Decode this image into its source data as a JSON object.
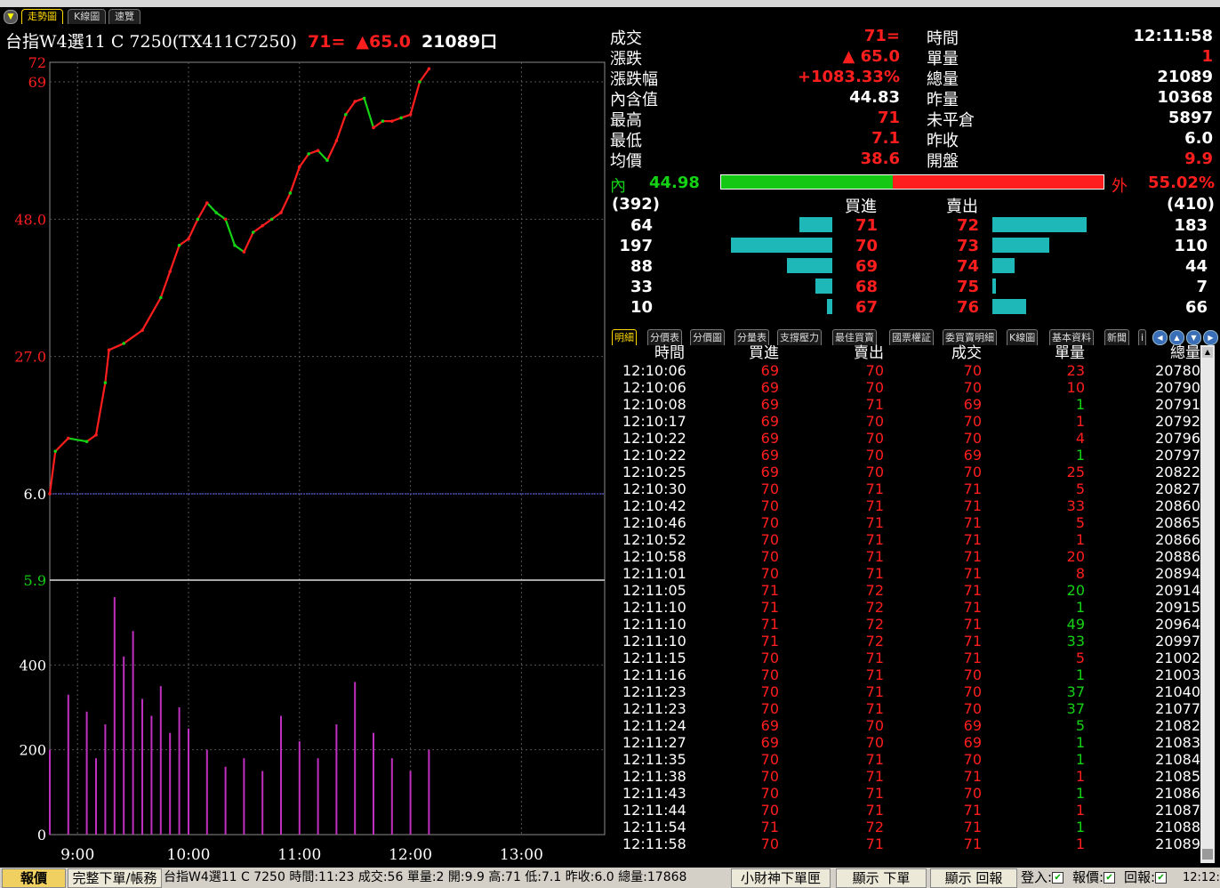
{
  "tabs": [
    {
      "label": "走勢圖",
      "active": true
    },
    {
      "label": "K線圖",
      "active": false
    },
    {
      "label": "速覽",
      "active": false
    }
  ],
  "header": {
    "name": "台指W4選11 C 7250(TX411C7250)",
    "price": "71=",
    "change": "▲65.0",
    "volume": "21089口"
  },
  "chart": {
    "price_ticks": [
      "72",
      "69",
      "48.0",
      "27.0",
      "6.0",
      "5.9"
    ],
    "volume_ticks": [
      "400",
      "200",
      "0"
    ],
    "time_ticks": [
      "9:00",
      "10:00",
      "11:00",
      "12:00",
      "13:00"
    ],
    "up_color": "#ff1e1e",
    "down_color": "#14d214",
    "avg_color": "#6a6aff",
    "vol_color": "#c030c0"
  },
  "chart_data": {
    "type": "line",
    "title": "",
    "xlabel": "",
    "ylabel": "",
    "x_range": [
      "8:45",
      "13:45"
    ],
    "ylim": [
      6.0,
      72
    ],
    "reference_price": 6.0,
    "price_series": {
      "x": [
        "8:45",
        "8:48",
        "8:55",
        "9:05",
        "9:10",
        "9:15",
        "9:17",
        "9:25",
        "9:35",
        "9:45",
        "9:50",
        "9:55",
        "10:00",
        "10:05",
        "10:10",
        "10:15",
        "10:20",
        "10:25",
        "10:30",
        "10:35",
        "10:40",
        "10:45",
        "10:50",
        "10:55",
        "11:00",
        "11:05",
        "11:10",
        "11:15",
        "11:20",
        "11:25",
        "11:30",
        "11:35",
        "11:40",
        "11:45",
        "11:50",
        "11:55",
        "12:00",
        "12:05",
        "12:10"
      ],
      "values": [
        6.0,
        12.5,
        14.5,
        14.0,
        15.0,
        23.0,
        28.0,
        29.0,
        31.0,
        36.0,
        40.0,
        44.0,
        45.0,
        48.0,
        50.5,
        49.0,
        48.0,
        44.0,
        43.0,
        46.0,
        47.0,
        48.0,
        49.0,
        52.0,
        56.0,
        58.0,
        58.5,
        57.0,
        60.0,
        64.0,
        66.0,
        66.5,
        62.0,
        63.0,
        63.0,
        63.5,
        64.0,
        69.0,
        71.0
      ]
    },
    "volume_series": {
      "ylim": [
        0,
        600
      ],
      "x": [
        "8:45",
        "8:55",
        "9:05",
        "9:10",
        "9:15",
        "9:20",
        "9:25",
        "9:30",
        "9:35",
        "9:40",
        "9:45",
        "9:50",
        "9:55",
        "10:00",
        "10:10",
        "10:20",
        "10:30",
        "10:40",
        "10:50",
        "11:00",
        "11:10",
        "11:20",
        "11:30",
        "11:40",
        "11:50",
        "12:00",
        "12:10"
      ],
      "values": [
        200,
        330,
        290,
        180,
        260,
        560,
        420,
        480,
        320,
        280,
        350,
        240,
        300,
        250,
        200,
        160,
        180,
        150,
        280,
        220,
        180,
        260,
        360,
        240,
        180,
        150,
        200
      ]
    }
  },
  "quote": {
    "left": [
      {
        "label": "成交",
        "value": "71=",
        "color": "red"
      },
      {
        "label": "漲跌",
        "value": "▲ 65.0",
        "color": "red"
      },
      {
        "label": "漲跌幅",
        "value": "+1083.33%",
        "color": "red"
      },
      {
        "label": "內含值",
        "value": "44.83",
        "color": "white"
      },
      {
        "label": "最高",
        "value": "71",
        "color": "red"
      },
      {
        "label": "最低",
        "value": "7.1",
        "color": "red"
      },
      {
        "label": "均價",
        "value": "38.6",
        "color": "red"
      }
    ],
    "right": [
      {
        "label": "時間",
        "value": "12:11:58",
        "color": "white"
      },
      {
        "label": "單量",
        "value": "1",
        "color": "red"
      },
      {
        "label": "總量",
        "value": "21089",
        "color": "white"
      },
      {
        "label": "昨量",
        "value": "10368",
        "color": "white"
      },
      {
        "label": "未平倉",
        "value": "5897",
        "color": "white"
      },
      {
        "label": "昨收",
        "value": "6.0",
        "color": "white"
      },
      {
        "label": "開盤",
        "value": "9.9",
        "color": "red"
      }
    ],
    "inner_label": "內",
    "inner_value": "44.98",
    "outer_label": "外",
    "outer_value": "55.02%",
    "inner_pct": 44.98
  },
  "depth": {
    "bid_total": "(392)",
    "ask_total": "(410)",
    "bid_header": "買進",
    "ask_header": "賣出",
    "max_qty": 197,
    "rows": [
      {
        "bid_qty": 64,
        "bid": "71",
        "ask": "72",
        "ask_qty": 183
      },
      {
        "bid_qty": 197,
        "bid": "70",
        "ask": "73",
        "ask_qty": 110
      },
      {
        "bid_qty": 88,
        "bid": "69",
        "ask": "74",
        "ask_qty": 44
      },
      {
        "bid_qty": 33,
        "bid": "68",
        "ask": "75",
        "ask_qty": 7
      },
      {
        "bid_qty": 10,
        "bid": "67",
        "ask": "76",
        "ask_qty": 66
      }
    ]
  },
  "subtabs": [
    "明細",
    "分價表",
    "分價圖",
    "分量表",
    "支撐壓力",
    "最佳買賣",
    "國票權証",
    "委買賣明細",
    "K線圖",
    "基本資料",
    "新聞",
    "i"
  ],
  "detail": {
    "headers": [
      "時間",
      "買進",
      "賣出",
      "成交",
      "單量",
      "總量"
    ],
    "rows": [
      [
        "12:10:06",
        "69",
        "70",
        "70",
        "23",
        "20780",
        "r"
      ],
      [
        "12:10:06",
        "69",
        "70",
        "70",
        "10",
        "20790",
        "r"
      ],
      [
        "12:10:08",
        "69",
        "71",
        "69",
        "1",
        "20791",
        "g"
      ],
      [
        "12:10:17",
        "69",
        "70",
        "70",
        "1",
        "20792",
        "r"
      ],
      [
        "12:10:22",
        "69",
        "70",
        "70",
        "4",
        "20796",
        "r"
      ],
      [
        "12:10:22",
        "69",
        "70",
        "69",
        "1",
        "20797",
        "g"
      ],
      [
        "12:10:25",
        "69",
        "70",
        "70",
        "25",
        "20822",
        "r"
      ],
      [
        "12:10:30",
        "70",
        "71",
        "71",
        "5",
        "20827",
        "r"
      ],
      [
        "12:10:42",
        "70",
        "71",
        "71",
        "33",
        "20860",
        "r"
      ],
      [
        "12:10:46",
        "70",
        "71",
        "71",
        "5",
        "20865",
        "r"
      ],
      [
        "12:10:52",
        "70",
        "71",
        "71",
        "1",
        "20866",
        "r"
      ],
      [
        "12:10:58",
        "70",
        "71",
        "71",
        "20",
        "20886",
        "r"
      ],
      [
        "12:11:01",
        "70",
        "71",
        "71",
        "8",
        "20894",
        "r"
      ],
      [
        "12:11:05",
        "71",
        "72",
        "71",
        "20",
        "20914",
        "g"
      ],
      [
        "12:11:10",
        "71",
        "72",
        "71",
        "1",
        "20915",
        "g"
      ],
      [
        "12:11:10",
        "71",
        "72",
        "71",
        "49",
        "20964",
        "g"
      ],
      [
        "12:11:10",
        "71",
        "72",
        "71",
        "33",
        "20997",
        "g"
      ],
      [
        "12:11:15",
        "70",
        "71",
        "71",
        "5",
        "21002",
        "r"
      ],
      [
        "12:11:16",
        "70",
        "71",
        "70",
        "1",
        "21003",
        "g"
      ],
      [
        "12:11:23",
        "70",
        "71",
        "70",
        "37",
        "21040",
        "g"
      ],
      [
        "12:11:23",
        "70",
        "71",
        "70",
        "37",
        "21077",
        "g"
      ],
      [
        "12:11:24",
        "69",
        "70",
        "69",
        "5",
        "21082",
        "g"
      ],
      [
        "12:11:27",
        "69",
        "70",
        "69",
        "1",
        "21083",
        "g"
      ],
      [
        "12:11:35",
        "70",
        "71",
        "70",
        "1",
        "21084",
        "g"
      ],
      [
        "12:11:38",
        "70",
        "71",
        "71",
        "1",
        "21085",
        "r"
      ],
      [
        "12:11:43",
        "70",
        "71",
        "70",
        "1",
        "21086",
        "g"
      ],
      [
        "12:11:44",
        "70",
        "71",
        "71",
        "1",
        "21087",
        "r"
      ],
      [
        "12:11:54",
        "71",
        "72",
        "71",
        "1",
        "21088",
        "g"
      ],
      [
        "12:11:58",
        "70",
        "71",
        "71",
        "1",
        "21089",
        "r"
      ]
    ]
  },
  "statusbar": {
    "quote_btn": "報價",
    "order_btn": "完整下單/帳務",
    "info": "台指W4選11 C 7250 時間:11:23 成交:56 單量:2 開:9.9 高:71 低:7.1 昨收:6.0 總量:17868",
    "btn1": "小財神下單匣",
    "btn2": "顯示 下單",
    "btn3": "顯示 回報",
    "login": "登入:",
    "quote_cb": "報價:",
    "report_cb": "回報:",
    "clock": "12:12:0"
  }
}
